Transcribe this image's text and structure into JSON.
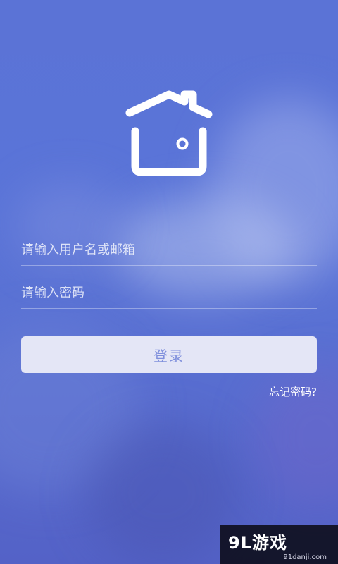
{
  "login": {
    "username_placeholder": "请输入用户名或邮箱",
    "password_placeholder": "请输入密码",
    "login_button": "登录",
    "forgot_password": "忘记密码?"
  },
  "watermark": {
    "logo": "9L游戏",
    "url": "91danji.com"
  },
  "colors": {
    "background": "#5a72d6",
    "button_bg": "#e4e6f6",
    "button_text": "#7f8fdc"
  },
  "icons": {
    "logo": "house-icon"
  }
}
